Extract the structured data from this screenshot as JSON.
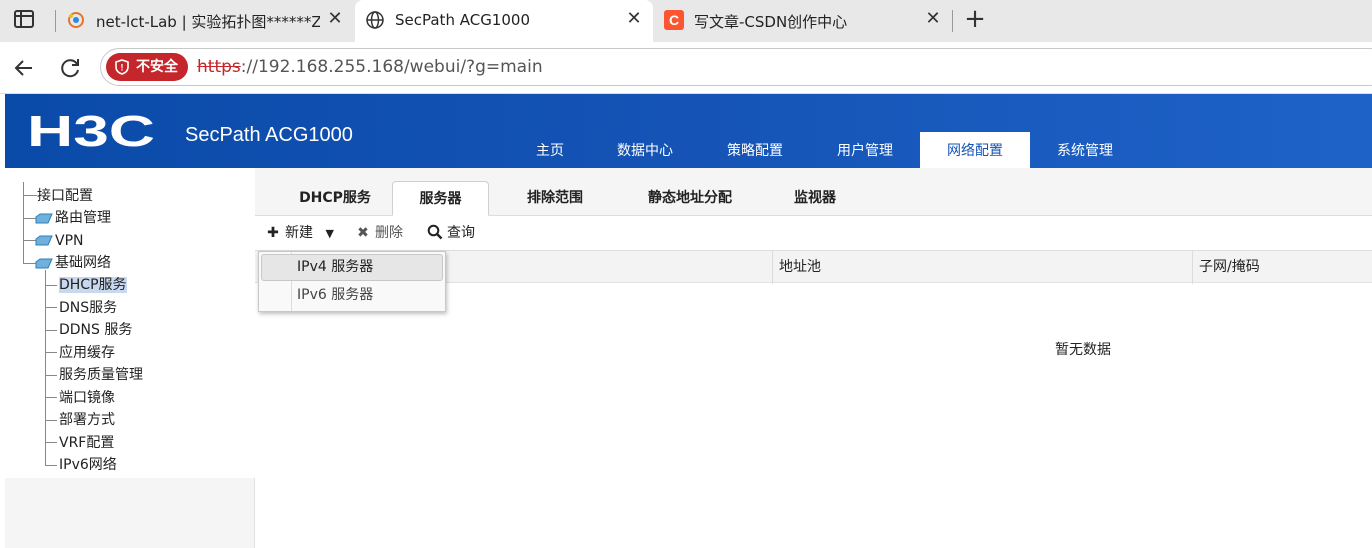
{
  "browser": {
    "tabs": [
      {
        "title": "net-lct-Lab | 实验拓扑图******Zhy",
        "icon": "netlab-favicon-icon",
        "active": false
      },
      {
        "title": "SecPath ACG1000",
        "icon": "globe-icon",
        "active": true
      },
      {
        "title": "写文章-CSDN创作中心",
        "icon": "csdn-favicon-icon",
        "active": false
      }
    ],
    "insecure_label": "不安全",
    "url_protocol": "https",
    "url_rest": "://192.168.255.168/webui/?g=main",
    "colors": {
      "insecure_bg": "#c4262c",
      "csdn_orange": "#fc5531"
    }
  },
  "app": {
    "logo": "H3C",
    "product": "SecPath ACG1000",
    "header_color": "#1554b6",
    "topnav": [
      {
        "label": "主页",
        "active": false
      },
      {
        "label": "数据中心",
        "active": false
      },
      {
        "label": "策略配置",
        "active": false
      },
      {
        "label": "用户管理",
        "active": false
      },
      {
        "label": "网络配置",
        "active": true
      },
      {
        "label": "系统管理",
        "active": false
      }
    ]
  },
  "tree": {
    "top": [
      {
        "label": "接口配置",
        "folder": false
      },
      {
        "label": "路由管理",
        "folder": true
      },
      {
        "label": "VPN",
        "folder": true
      },
      {
        "label": "基础网络",
        "folder": true
      }
    ],
    "children": [
      {
        "label": "DHCP服务",
        "selected": true
      },
      {
        "label": "DNS服务",
        "selected": false
      },
      {
        "label": "DDNS 服务",
        "selected": false
      },
      {
        "label": "应用缓存",
        "selected": false
      },
      {
        "label": "服务质量管理",
        "selected": false
      },
      {
        "label": "端口镜像",
        "selected": false
      },
      {
        "label": "部署方式",
        "selected": false
      },
      {
        "label": "VRF配置",
        "selected": false
      },
      {
        "label": "IPv6网络",
        "selected": false
      }
    ]
  },
  "subtabs": [
    {
      "label": "DHCP服务",
      "active": false
    },
    {
      "label": "服务器",
      "active": true
    },
    {
      "label": "排除范围",
      "active": false
    },
    {
      "label": "静态地址分配",
      "active": false
    },
    {
      "label": "监视器",
      "active": false
    }
  ],
  "toolbar": {
    "new_label": "新建",
    "delete_label": "删除",
    "query_label": "查询"
  },
  "grid": {
    "columns": [
      "",
      "地址池",
      "子网/掩码"
    ],
    "empty_text": "暂无数据"
  },
  "dropdown": {
    "items": [
      {
        "label": "IPv4 服务器",
        "hover": true
      },
      {
        "label": "IPv6 服务器",
        "hover": false
      }
    ]
  }
}
